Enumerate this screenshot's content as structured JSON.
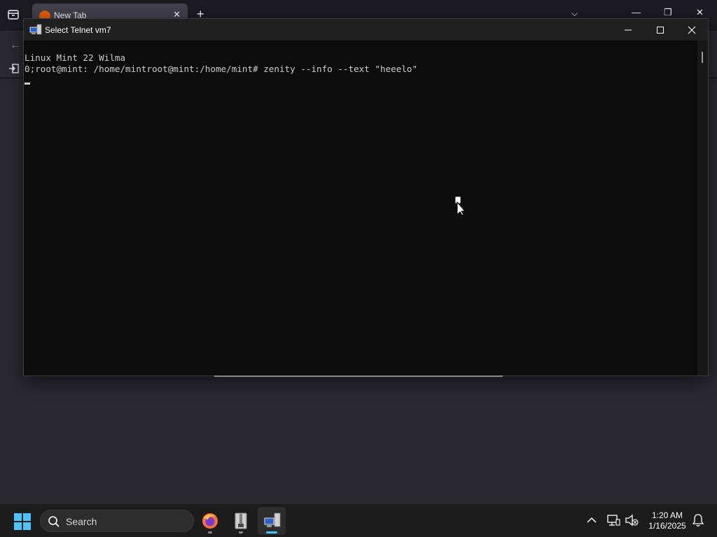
{
  "browser": {
    "tab_title": "New Tab",
    "new_tab_glyph": "+"
  },
  "telnet": {
    "title": "Select Telnet vm7",
    "lines": [
      "Linux Mint 22 Wilma",
      "0;root@mint: /home/mintroot@mint:/home/mint# zenity --info --text \"heeelo\""
    ]
  },
  "taskbar": {
    "search_label": "Search",
    "time": "1:20 AM",
    "date": "1/16/2025",
    "apps": [
      "firefox-icon",
      "archive-icon",
      "telnet-icon"
    ],
    "accent_color": "#4cc2ff"
  }
}
